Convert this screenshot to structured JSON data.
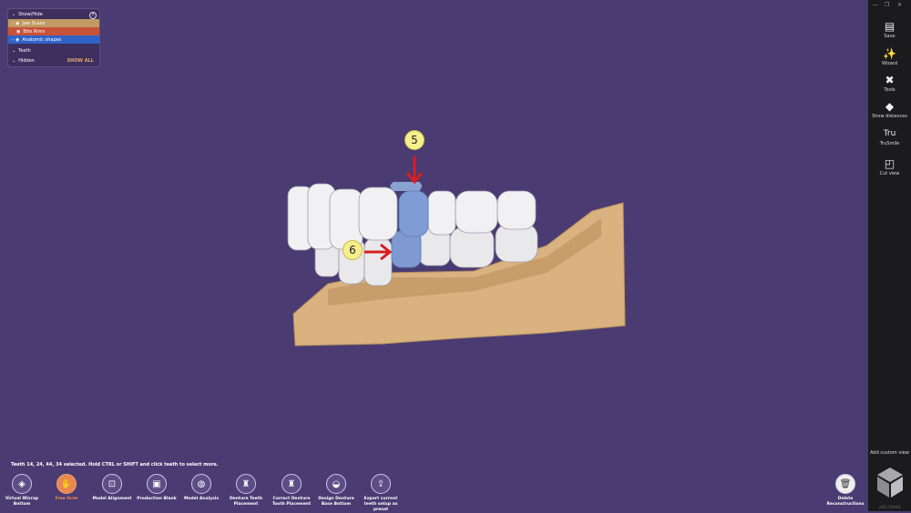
{
  "panel": {
    "header": "Show/Hide",
    "rows": [
      {
        "label": "Jaw Scans",
        "color": "#c09a62"
      },
      {
        "label": "Bite Rims",
        "color": "#c8523a"
      },
      {
        "label": "Anatomic shapes",
        "color": "#2f63c8"
      }
    ],
    "teeth": "Teeth",
    "hidden": "Hidden",
    "show_all": "SHOW ALL"
  },
  "markers": {
    "upper": "5",
    "lower": "6"
  },
  "status": "Teeth 14, 24, 44, 34 selected. Hold CTRL or SHIFT and click teeth to select more.",
  "toolbar": [
    {
      "label": "Virtual Wizrap Bottom",
      "active": false
    },
    {
      "label": "Free form",
      "active": true
    },
    {
      "label": "Model Alignment",
      "active": false
    },
    {
      "label": "Production Blank",
      "active": false
    },
    {
      "label": "Model Analysis",
      "active": false
    },
    {
      "label": "Denture Teeth Placement",
      "active": false
    },
    {
      "label": "Correct Denture Tooth Placement",
      "active": false
    },
    {
      "label": "Design Denture Base Bottom",
      "active": false
    },
    {
      "label": "Export current teeth setup as preset",
      "active": false
    }
  ],
  "delete_label": "Delete Reconstructions",
  "sidebar": [
    {
      "label": "Save",
      "icon": "save-icon"
    },
    {
      "label": "Wizard",
      "icon": "wand-icon"
    },
    {
      "label": "Tools",
      "icon": "tools-icon"
    },
    {
      "label": "Show distances",
      "icon": "distance-icon"
    },
    {
      "label": "TruSmile",
      "icon": "trusmile-icon"
    },
    {
      "label": "Cut view",
      "icon": "cut-view-icon"
    }
  ],
  "trusmile_glyph": "Tru",
  "add_view": "Add custom view",
  "version": "v10.7.0+64"
}
